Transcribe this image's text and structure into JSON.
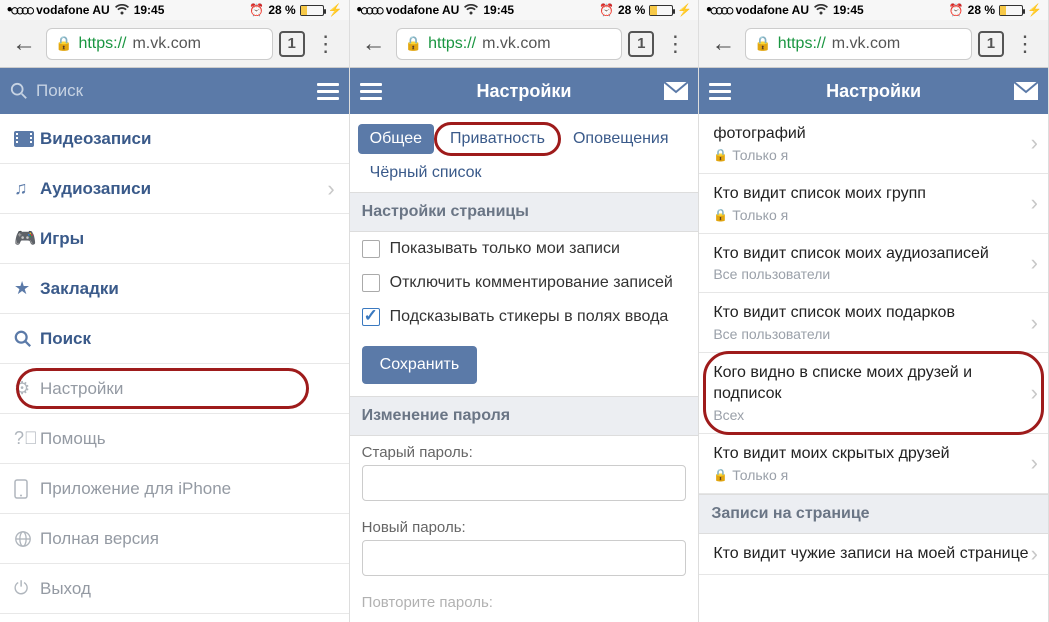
{
  "status": {
    "signal": "•○○○○",
    "carrier": "vodafone AU",
    "time": "19:45",
    "alarm": "⏰",
    "battery_pct": "28 %",
    "charging": "⚡"
  },
  "browser": {
    "url_secure": "https://",
    "url_rest": "m.vk.com",
    "tab_count": "1"
  },
  "panel1": {
    "search_placeholder": "Поиск",
    "menu": [
      {
        "label": "Видеозаписи"
      },
      {
        "label": "Аудиозаписи"
      },
      {
        "label": "Игры"
      },
      {
        "label": "Закладки"
      },
      {
        "label": "Поиск"
      },
      {
        "label": "Настройки"
      },
      {
        "label": "Помощь"
      },
      {
        "label": "Приложение для iPhone"
      },
      {
        "label": "Полная версия"
      },
      {
        "label": "Выход"
      }
    ]
  },
  "panel2": {
    "header_title": "Настройки",
    "tabs": {
      "general": "Общее",
      "privacy": "Приватность",
      "notifications": "Оповещения",
      "blacklist": "Чёрный список"
    },
    "page_settings_head": "Настройки страницы",
    "chk_only_my": "Показывать только мои записи",
    "chk_disable_comments": "Отключить комментирование записей",
    "chk_stickers": "Подсказывать стикеры в полях ввода",
    "save_btn": "Сохранить",
    "change_pw_head": "Изменение пароля",
    "old_pw_label": "Старый пароль:",
    "new_pw_label": "Новый пароль:",
    "repeat_pw_label": "Повторите пароль:"
  },
  "panel3": {
    "header_title": "Настройки",
    "rows": {
      "photos_title": "фотографий",
      "only_me": "Только я",
      "groups_title": "Кто видит список моих групп",
      "audio_title": "Кто видит список моих аудиозаписей",
      "all_users": "Все пользователи",
      "gifts_title": "Кто видит список моих подарков",
      "friends_title": "Кого видно в списке моих друзей и подписок",
      "everyone": "Всех",
      "hidden_title": "Кто видит моих скрытых друзей",
      "wall_head": "Записи на странице",
      "others_title": "Кто видит чужие записи на моей странице"
    }
  }
}
